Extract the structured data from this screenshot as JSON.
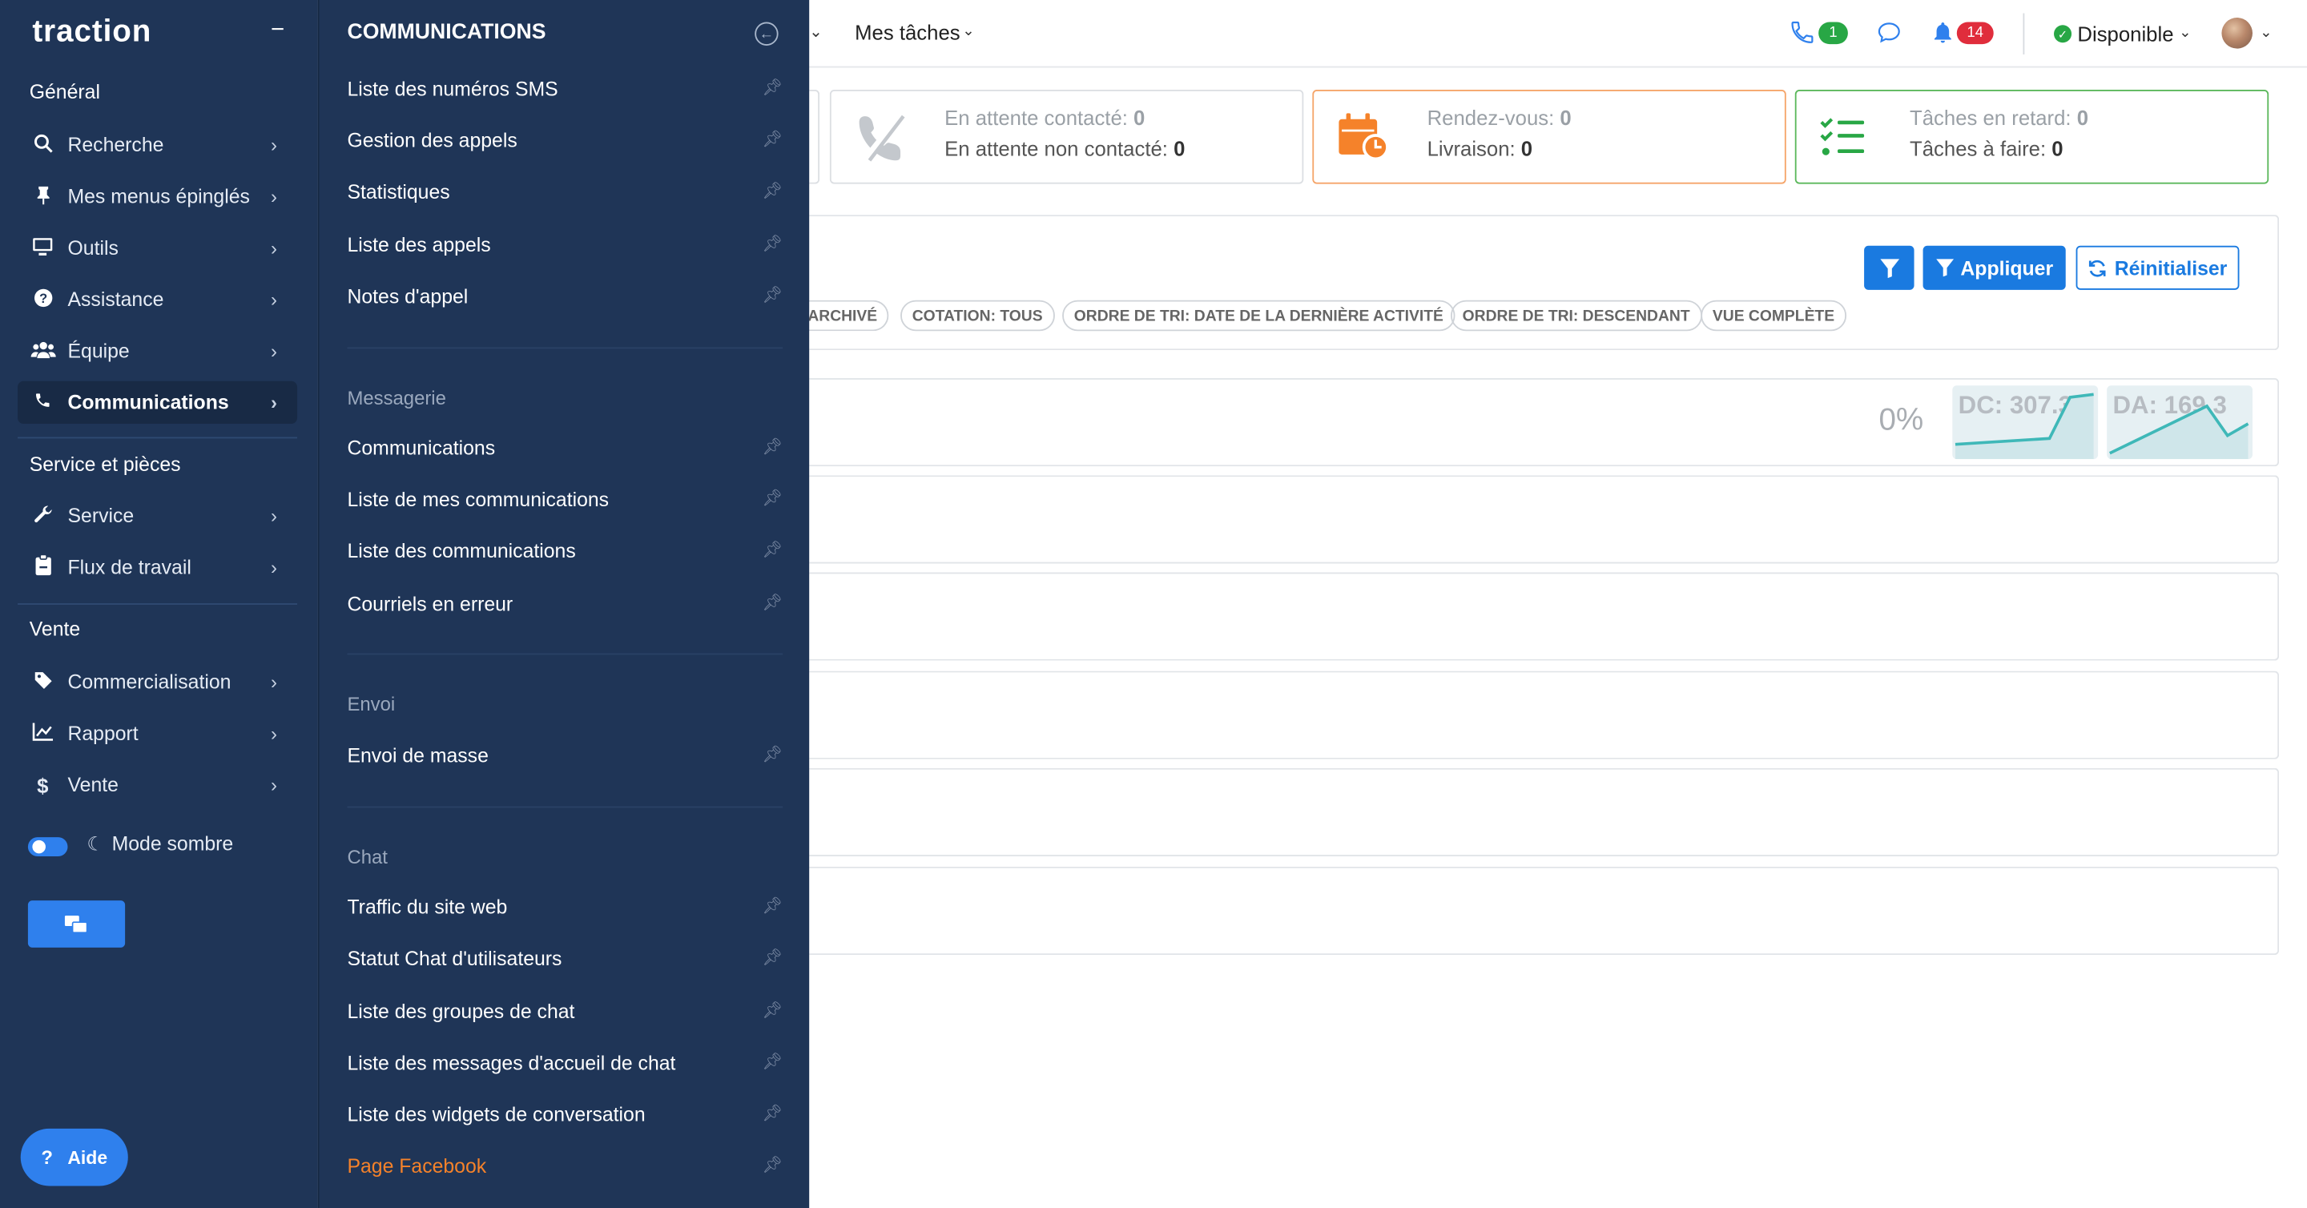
{
  "sidebar": {
    "logo": "traction",
    "collapse_icon": "minus-icon",
    "sections": {
      "general": "Général",
      "service": "Service et pièces",
      "vente": "Vente"
    },
    "items": [
      {
        "label": "Recherche",
        "icon": "search-icon"
      },
      {
        "label": "Mes menus épinglés",
        "icon": "pin-icon"
      },
      {
        "label": "Outils",
        "icon": "monitor-icon"
      },
      {
        "label": "Assistance",
        "icon": "question-icon"
      },
      {
        "label": "Équipe",
        "icon": "users-icon"
      },
      {
        "label": "Communications",
        "icon": "phone-icon"
      },
      {
        "label": "Service",
        "icon": "wrench-icon"
      },
      {
        "label": "Flux de travail",
        "icon": "clipboard-icon"
      },
      {
        "label": "Commercialisation",
        "icon": "tag-icon"
      },
      {
        "label": "Rapport",
        "icon": "chart-line-icon"
      },
      {
        "label": "Vente",
        "icon": "dollar-icon"
      }
    ],
    "dark_mode_label": "Mode sombre",
    "help_label": "Aide"
  },
  "panel": {
    "title": "COMMUNICATIONS",
    "group1": [
      "Liste des numéros SMS",
      "Gestion des appels",
      "Statistiques",
      "Liste des appels",
      "Notes d'appel"
    ],
    "messagerie_title": "Messagerie",
    "messagerie": [
      "Communications",
      "Liste de mes communications",
      "Liste des communications",
      "Courriels en erreur"
    ],
    "envoi_title": "Envoi",
    "envoi": [
      "Envoi de masse"
    ],
    "chat_title": "Chat",
    "chat": [
      "Traffic du site web",
      "Statut Chat d'utilisateurs",
      "Liste des groupes de chat",
      "Liste des messages d'accueil de chat",
      "Liste des widgets de conversation",
      "Page Facebook"
    ]
  },
  "topbar": {
    "my_tasks": "Mes tâches",
    "phone_badge": "1",
    "notif_badge": "14",
    "status": "Disponible"
  },
  "cards": {
    "contact": {
      "l1": "En attente contacté:",
      "v1": "0",
      "l2": "En attente non contacté:",
      "v2": "0"
    },
    "rdv": {
      "l1": "Rendez-vous:",
      "v1": "0",
      "l2": "Livraison:",
      "v2": "0"
    },
    "tasks": {
      "l1": "Tâches en retard:",
      "v1": "0",
      "l2": "Tâches à faire:",
      "v2": "0"
    }
  },
  "filters": {
    "apply": "Appliquer",
    "reset": "Réinitialiser",
    "tags": [
      "ARCHIVÉ",
      "COTATION: TOUS",
      "ORDRE DE TRI: DATE DE LA DERNIÈRE ACTIVITÉ",
      "ORDRE DE TRI: DESCENDANT",
      "VUE COMPLÈTE"
    ]
  },
  "stats": {
    "percent": "0%",
    "dc": "DC: 307.3",
    "da": "DA: 169.3"
  },
  "colors": {
    "sidebar_bg": "#1f3557",
    "accent": "#1a7ae0",
    "orange": "#f5822a",
    "green": "#28a745",
    "red_badge": "#e02d3c"
  }
}
